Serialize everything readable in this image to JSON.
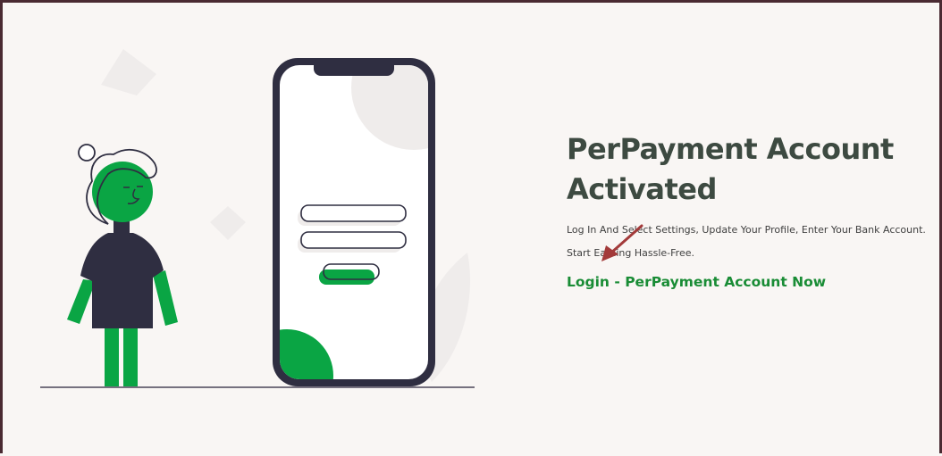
{
  "page": {
    "title": "PerPayment Account Activated",
    "description": "Log In And Select Settings, Update Your Profile, Enter Your Bank Account. Start Earning Hassle-Free.",
    "login_link": "Login - PerPayment Account Now"
  },
  "icons": {
    "illustration": "person-with-phone-illustration",
    "annotation": "red-arrow-icon"
  },
  "colors": {
    "accent_green": "#0aa544",
    "link_green": "#198c35",
    "dark": "#2f2e41",
    "title": "#3d4a41",
    "background": "#f9f6f4",
    "annotation_arrow": "#a33a3a"
  }
}
